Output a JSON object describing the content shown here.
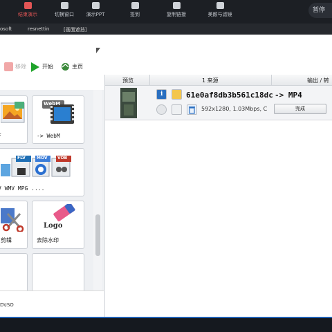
{
  "meeting_toolbar": {
    "items": [
      {
        "label": "结束演示",
        "icon": "screen-share-icon"
      },
      {
        "label": "切换窗口",
        "icon": "window-switch-icon"
      },
      {
        "label": "演示PPT",
        "icon": "ppt-icon"
      },
      {
        "label": "签到",
        "icon": "checkin-icon"
      },
      {
        "label": "复制链接",
        "icon": "user-link-icon"
      },
      {
        "label": "美颜与滤镜",
        "icon": "sparkle-icon"
      }
    ],
    "pause_label": "暂停",
    "active_color": "#e25555"
  },
  "window_bar": {
    "tabs": [
      "osoft",
      "resnettin",
      "[画面遮挡]"
    ]
  },
  "app_toolbar": {
    "remove_label": "移除",
    "start_label": "开始",
    "home_label": "主页"
  },
  "left_panel": {
    "tiles": [
      {
        "label": "F",
        "icon": "image-convert-icon"
      },
      {
        "label": "-> WebM",
        "icon": "webm-icon"
      },
      {
        "label": "V WMV MPG ....",
        "icon": "video-formats-icon"
      },
      {
        "label": "剪辑",
        "icon": "scissors-icon"
      },
      {
        "label": "去除水印",
        "icon": "watermark-eraser-icon"
      }
    ],
    "format_badges": [
      "FLV",
      "MOV",
      "VOB"
    ],
    "logo_text": "Logo",
    "webm_badge": "WebM",
    "bottom_label": "D\\ISO"
  },
  "list": {
    "headers": {
      "preview": "预览",
      "source": "1 来源",
      "output": "输出 / 转"
    },
    "rows": [
      {
        "name": "61e0af8db3b561c18dc",
        "target": "-> MP4",
        "info": "592x1280, 1.03Mbps, C",
        "status": "完成"
      }
    ]
  },
  "colors": {
    "accent_blue": "#1e5fb3",
    "start_green": "#1fa32a"
  }
}
